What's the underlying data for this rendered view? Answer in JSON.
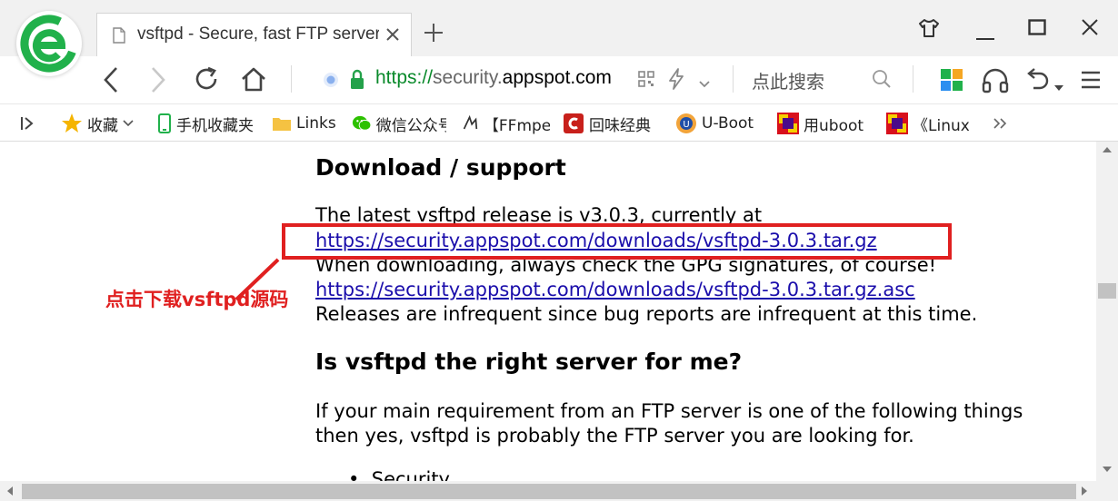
{
  "tab": {
    "title": "vsftpd - Secure, fast FTP server for UNIX-like systems"
  },
  "address": {
    "scheme": "https://",
    "subdomain": "security.",
    "domain": "appspot.com",
    "path": "/"
  },
  "search": {
    "placeholder": "点此搜索"
  },
  "bookmarks": [
    {
      "label": "收藏",
      "icon": "star-icon"
    },
    {
      "label": "手机收藏夹",
      "icon": "phone-icon"
    },
    {
      "label": "Links",
      "icon": "folder-icon"
    },
    {
      "label": "微信公众号",
      "icon": "wechat-icon"
    },
    {
      "label": "【FFmpeg",
      "icon": "site-icon"
    },
    {
      "label": "回味经典",
      "icon": "site-icon"
    },
    {
      "label": "U-Boot",
      "icon": "site-icon"
    },
    {
      "label": "用uboot",
      "icon": "site-icon"
    },
    {
      "label": "《Linux",
      "icon": "site-icon"
    }
  ],
  "page": {
    "heading1": "Download / support",
    "release_text": "The latest vsftpd release is v3.0.3, currently at",
    "download_link": "https://security.appspot.com/downloads/vsftpd-3.0.3.tar.gz",
    "gpg_text": "When downloading, always check the GPG signatures, of course!",
    "asc_link": "https://security.appspot.com/downloads/vsftpd-3.0.3.tar.gz.asc",
    "infrequent_text": "Releases are infrequent since bug reports are infrequent at this time.",
    "heading2": "Is vsftpd the right server for me?",
    "req_line1": "If your main requirement from an FTP server is one of the following things",
    "req_line2": "then yes, vsftpd is probably the FTP server you are looking for.",
    "bullet1": "Security"
  },
  "annotation": {
    "text": "点击下载vsftpd源码",
    "color": "#e02020"
  },
  "colors": {
    "accent_green": "#0a8a2b",
    "link": "#1a0dab",
    "annotation_red": "#e02020"
  }
}
